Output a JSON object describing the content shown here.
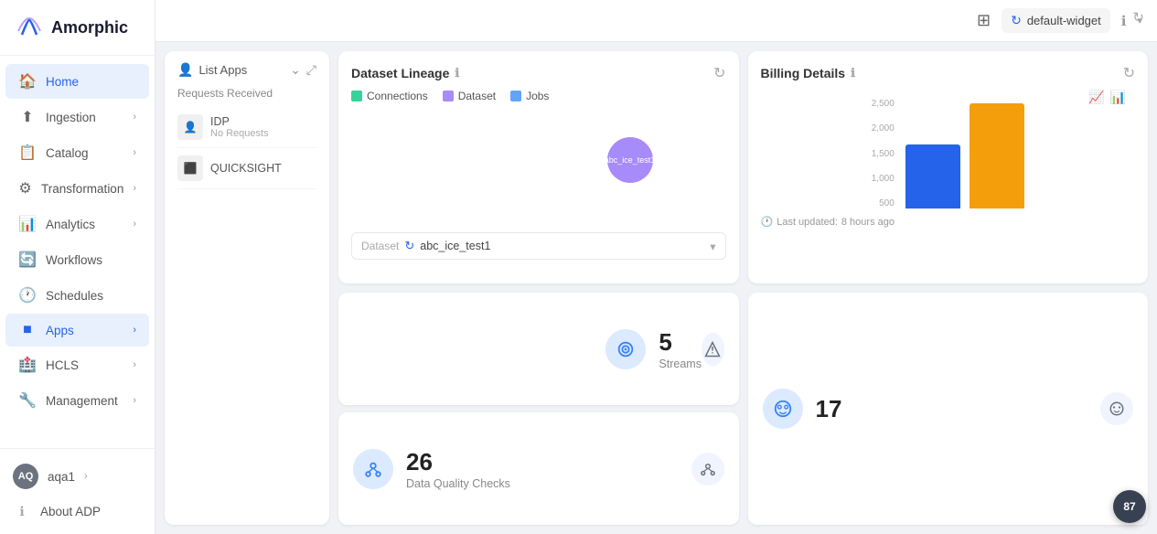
{
  "sidebar": {
    "logo_text": "Amorphic",
    "nav_items": [
      {
        "id": "home",
        "label": "Home",
        "icon": "🏠",
        "active": true,
        "has_chevron": false
      },
      {
        "id": "ingestion",
        "label": "Ingestion",
        "icon": "⬆",
        "active": false,
        "has_chevron": true
      },
      {
        "id": "catalog",
        "label": "Catalog",
        "icon": "📋",
        "active": false,
        "has_chevron": true
      },
      {
        "id": "transformation",
        "label": "Transformation",
        "icon": "⚙",
        "active": false,
        "has_chevron": true
      },
      {
        "id": "analytics",
        "label": "Analytics",
        "icon": "📊",
        "active": false,
        "has_chevron": true
      },
      {
        "id": "workflows",
        "label": "Workflows",
        "icon": "🔄",
        "active": false,
        "has_chevron": false
      },
      {
        "id": "schedules",
        "label": "Schedules",
        "icon": "🕐",
        "active": false,
        "has_chevron": false
      },
      {
        "id": "apps",
        "label": "Apps",
        "icon": "⬛",
        "active": true,
        "has_chevron": true
      },
      {
        "id": "hcls",
        "label": "HCLS",
        "icon": "🏥",
        "active": false,
        "has_chevron": true
      },
      {
        "id": "management",
        "label": "Management",
        "icon": "🔧",
        "active": false,
        "has_chevron": true
      }
    ],
    "user": {
      "initials": "AQ",
      "name": "aqa1",
      "chevron": true
    },
    "about": "About ADP"
  },
  "topbar": {
    "layout_icon": "⊞",
    "widget_label": "default-widget",
    "info_icon": "ℹ",
    "chevron": "▾"
  },
  "list_apps": {
    "title": "List Apps",
    "header_icon": "👤",
    "requests_label": "Requests Received",
    "items": [
      {
        "name": "IDP",
        "status": "No Requests",
        "icon": "👤"
      },
      {
        "name": "QUICKSIGHT",
        "status": "",
        "icon": "⬛"
      }
    ]
  },
  "dataset_lineage": {
    "title": "Dataset Lineage",
    "legend": [
      {
        "label": "Connections",
        "color": "#34d399"
      },
      {
        "label": "Dataset",
        "color": "#a78bfa"
      },
      {
        "label": "Jobs",
        "color": "#60a5fa"
      }
    ],
    "node_label": "abc_ice_test1",
    "dataset_selector_label": "Dataset",
    "selected_dataset": "abc_ice_test1"
  },
  "billing": {
    "title": "Billing Details",
    "y_axis": [
      "2,500",
      "2,000",
      "1,500",
      "1,000",
      "500"
    ],
    "bars": [
      {
        "height": 70,
        "color": "#2563eb"
      },
      {
        "height": 115,
        "color": "#f59e0b"
      }
    ],
    "last_updated_label": "Last updated:",
    "last_updated_time": "8 hours ago"
  },
  "stats": [
    {
      "number": "5",
      "label": "Streams",
      "icon": "⊕"
    },
    {
      "number": "26",
      "label": "Data Quality Checks",
      "icon": "⊙"
    },
    {
      "number": "17",
      "label": "",
      "icon": "⊛"
    }
  ],
  "corner_badge": {
    "number": "87"
  }
}
